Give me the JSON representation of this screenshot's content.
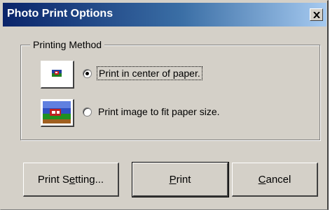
{
  "window": {
    "title": "Photo Print Options",
    "close_glyph": "×"
  },
  "printing_method": {
    "group_label": "Printing Method",
    "options": [
      {
        "label": "Print in center of paper.",
        "selected": true,
        "icon": "center-print-thumbnail-icon"
      },
      {
        "label": "Print image to fit paper size.",
        "selected": false,
        "icon": "fit-print-thumbnail-icon"
      }
    ]
  },
  "buttons": {
    "print_setting": {
      "pre": "Print S",
      "u": "e",
      "post": "tting..."
    },
    "print": {
      "pre": "",
      "u": "P",
      "post": "rint"
    },
    "cancel": {
      "pre": "",
      "u": "C",
      "post": "ancel"
    }
  },
  "colors": {
    "titlebar_start": "#0a246a",
    "titlebar_end": "#a6caf0",
    "face": "#d4d0c8"
  }
}
